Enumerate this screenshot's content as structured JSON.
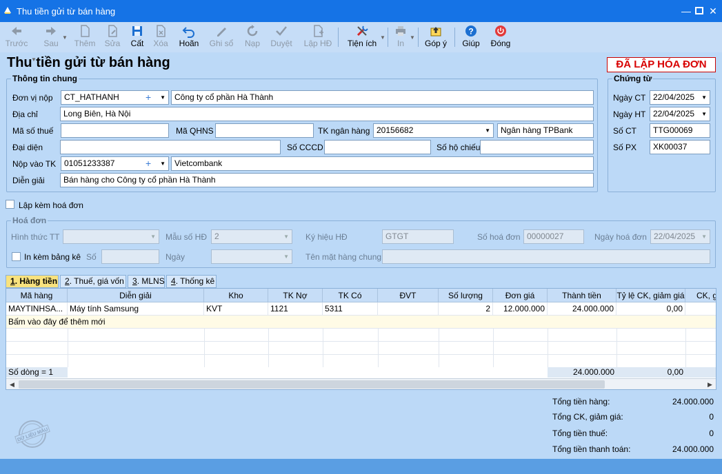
{
  "window": {
    "title": "Thu tiền gửi từ bán hàng"
  },
  "toolbar": {
    "prev": "Trước",
    "next": "Sau",
    "add": "Thêm",
    "edit": "Sửa",
    "save": "Cất",
    "delete": "Xóa",
    "undo": "Hoãn",
    "post": "Ghi sổ",
    "unpost": "Nạp",
    "approve": "Duyệt",
    "invoice": "Lập HĐ",
    "utilities": "Tiện ích",
    "print": "In",
    "feedback": "Góp ý",
    "help": "Giúp",
    "close": "Đóng"
  },
  "heading": "Thu tiền gửi từ bán hàng",
  "badge": "ĐÃ LẬP HÓA ĐƠN",
  "general": {
    "title": "Thông tin chung",
    "payer_label": "Đơn vị nộp",
    "payer_code": "CT_HATHANH",
    "payer_name": "Công ty cổ phần Hà Thành",
    "address_label": "Địa chỉ",
    "address": "Long Biên, Hà Nội",
    "tax_label": "Mã số thuế",
    "tax": "",
    "qhns_label": "Mã QHNS",
    "qhns": "",
    "bank_acc_label": "TK ngân hàng",
    "bank_acc": "20156682",
    "bank_name": "Ngân hàng TPBank",
    "rep_label": "Đại diện",
    "rep": "",
    "cccd_label": "Số CCCD",
    "cccd": "",
    "passport_label": "Số hộ chiếu",
    "passport": "",
    "deposit_label": "Nộp vào TK",
    "deposit_acc": "01051233387",
    "deposit_bank": "Vietcombank",
    "desc_label": "Diễn giải",
    "desc": "Bán hàng cho Công ty cổ phần Hà Thành"
  },
  "voucher": {
    "title": "Chứng từ",
    "date_ct_label": "Ngày CT",
    "date_ct": "22/04/2025",
    "date_ht_label": "Ngày HT",
    "date_ht": "22/04/2025",
    "no_ct_label": "Số CT",
    "no_ct": "TTG00069",
    "no_px_label": "Số PX",
    "no_px": "XK00037"
  },
  "attach_invoice_label": "Lập kèm hoá đơn",
  "invoice": {
    "title": "Hoá đơn",
    "form_tt_label": "Hình thức TT",
    "form_tt": "",
    "template_label": "Mẫu số HĐ",
    "template": "2",
    "symbol_label": "Ký hiệu HĐ",
    "symbol": "GTGT",
    "number_label": "Số hoá đơn",
    "number": "00000027",
    "date_label": "Ngày hoá đơn",
    "date": "22/04/2025",
    "print_list_label": "In kèm bảng kê",
    "list_no_label": "Số",
    "list_no": "",
    "list_date_label": "Ngày",
    "list_date": "",
    "general_goods_label": "Tên mặt hàng chung",
    "general_goods": ""
  },
  "tabs": [
    {
      "num": "1",
      "label": ". Hàng tiền"
    },
    {
      "num": "2",
      "label": ". Thuế, giá vốn"
    },
    {
      "num": "3",
      "label": ". MLNS"
    },
    {
      "num": "4",
      "label": ". Thống kê"
    }
  ],
  "grid": {
    "headers": [
      "Mã hàng",
      "Diễn giải",
      "Kho",
      "TK Nợ",
      "TK Có",
      "ĐVT",
      "Số lượng",
      "Đơn giá",
      "Thành tiền",
      "Tỷ lệ CK, giảm giá",
      "CK, g"
    ],
    "row": [
      "MAYTINHSA...",
      "Máy tính Samsung",
      "KVT",
      "1121",
      "5311",
      "",
      "2",
      "12.000.000",
      "24.000.000",
      "0,00",
      ""
    ],
    "add_hint": "Bấm vào đây để thêm mới",
    "footer_count": "Số dòng = 1",
    "footer_amount": "24.000.000",
    "footer_rate": "0,00"
  },
  "totals": {
    "goods_label": "Tổng tiền hàng:",
    "goods": "24.000.000",
    "discount_label": "Tổng CK, giảm giá:",
    "discount": "0",
    "tax_label": "Tổng tiền thuế:",
    "tax": "0",
    "pay_label": "Tổng tiền thanh toán:",
    "pay": "24.000.000"
  },
  "watermark": "DỮ LIỆU MẪU"
}
